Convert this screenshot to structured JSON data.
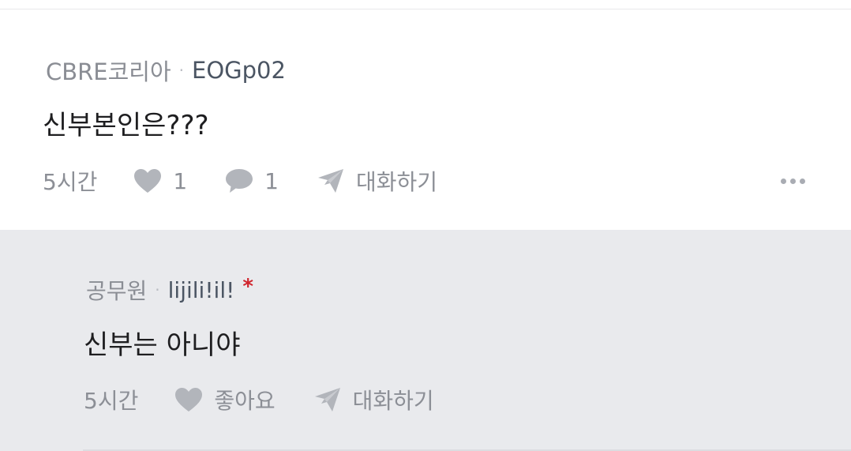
{
  "comment": {
    "company": "CBRE코리아",
    "separator": "·",
    "nickname": "EOGp02",
    "text": "신부본인은???",
    "time": "5시간",
    "likes": "1",
    "replies": "1",
    "chat_label": "대화하기",
    "more_icon": "more-horizontal-icon"
  },
  "reply": {
    "company": "공무원",
    "separator": "·",
    "nickname": "lijili!il!",
    "author_mark": "*",
    "text": "신부는 아니야",
    "time": "5시간",
    "like_label": "좋아요",
    "chat_label": "대화하기"
  },
  "colors": {
    "reply_background": "#e9eaed",
    "author_mark": "#d0262e",
    "icon_gray": "#b2b5bb"
  }
}
